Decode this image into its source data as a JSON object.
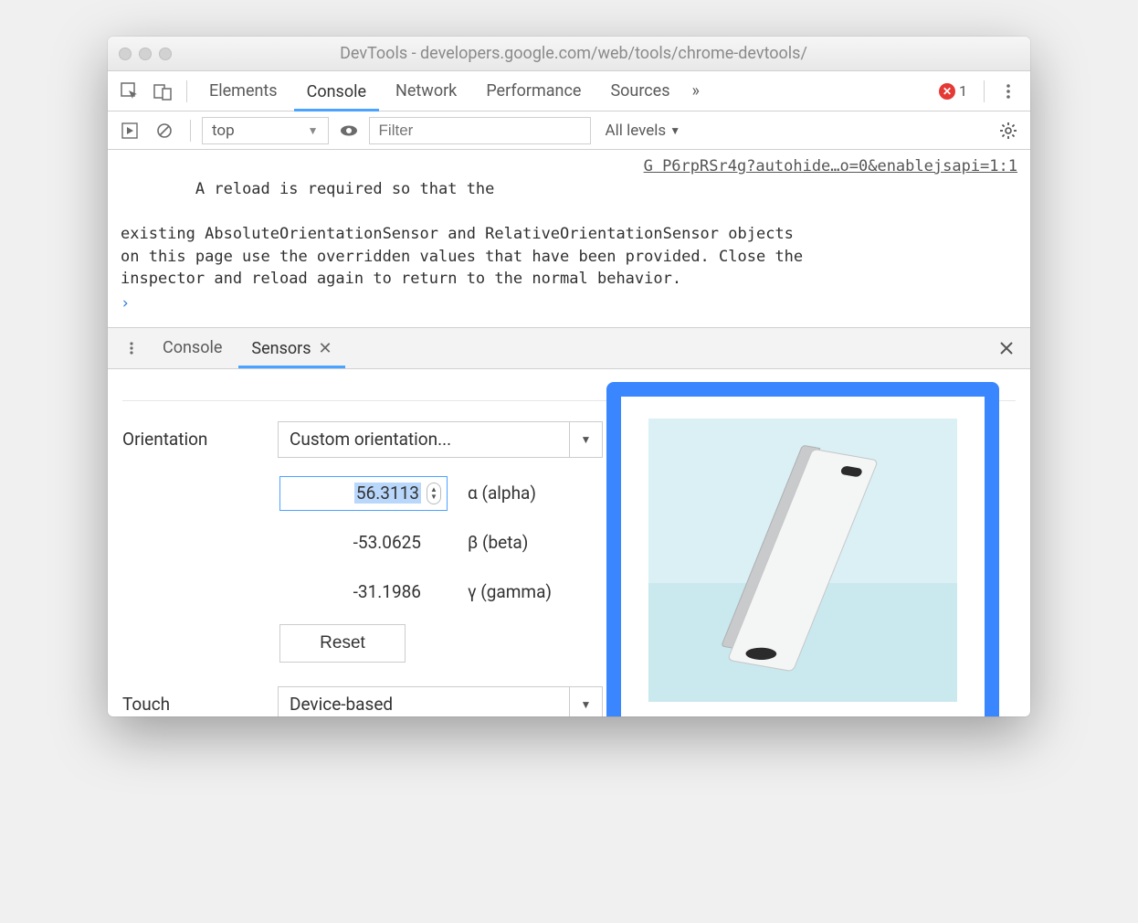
{
  "window": {
    "title": "DevTools - developers.google.com/web/tools/chrome-devtools/"
  },
  "mainTabs": {
    "elements": "Elements",
    "console": "Console",
    "network": "Network",
    "performance": "Performance",
    "sources": "Sources",
    "more": "»",
    "errorCount": "1"
  },
  "consoleToolbar": {
    "context": "top",
    "filterPlaceholder": "Filter",
    "levels": "All levels"
  },
  "consoleLog": {
    "line1": "A reload is required so that the",
    "source": "G P6rpRSr4g?autohide…o=0&enablejsapi=1:1",
    "line2": "existing AbsoluteOrientationSensor and RelativeOrientationSensor objects",
    "line3": "on this page use the overridden values that have been provided. Close the",
    "line4": "inspector and reload again to return to the normal behavior.",
    "promptGlyph": "›"
  },
  "drawer": {
    "consoleTab": "Console",
    "sensorsTab": "Sensors"
  },
  "sensors": {
    "orientationLabel": "Orientation",
    "orientationSelect": "Custom orientation...",
    "alphaValue": "56.3113",
    "alphaLabel": "α (alpha)",
    "betaValue": "-53.0625",
    "betaLabel": "β (beta)",
    "gammaValue": "-31.1986",
    "gammaLabel": "γ (gamma)",
    "resetLabel": "Reset",
    "touchLabel": "Touch",
    "touchSelect": "Device-based"
  }
}
